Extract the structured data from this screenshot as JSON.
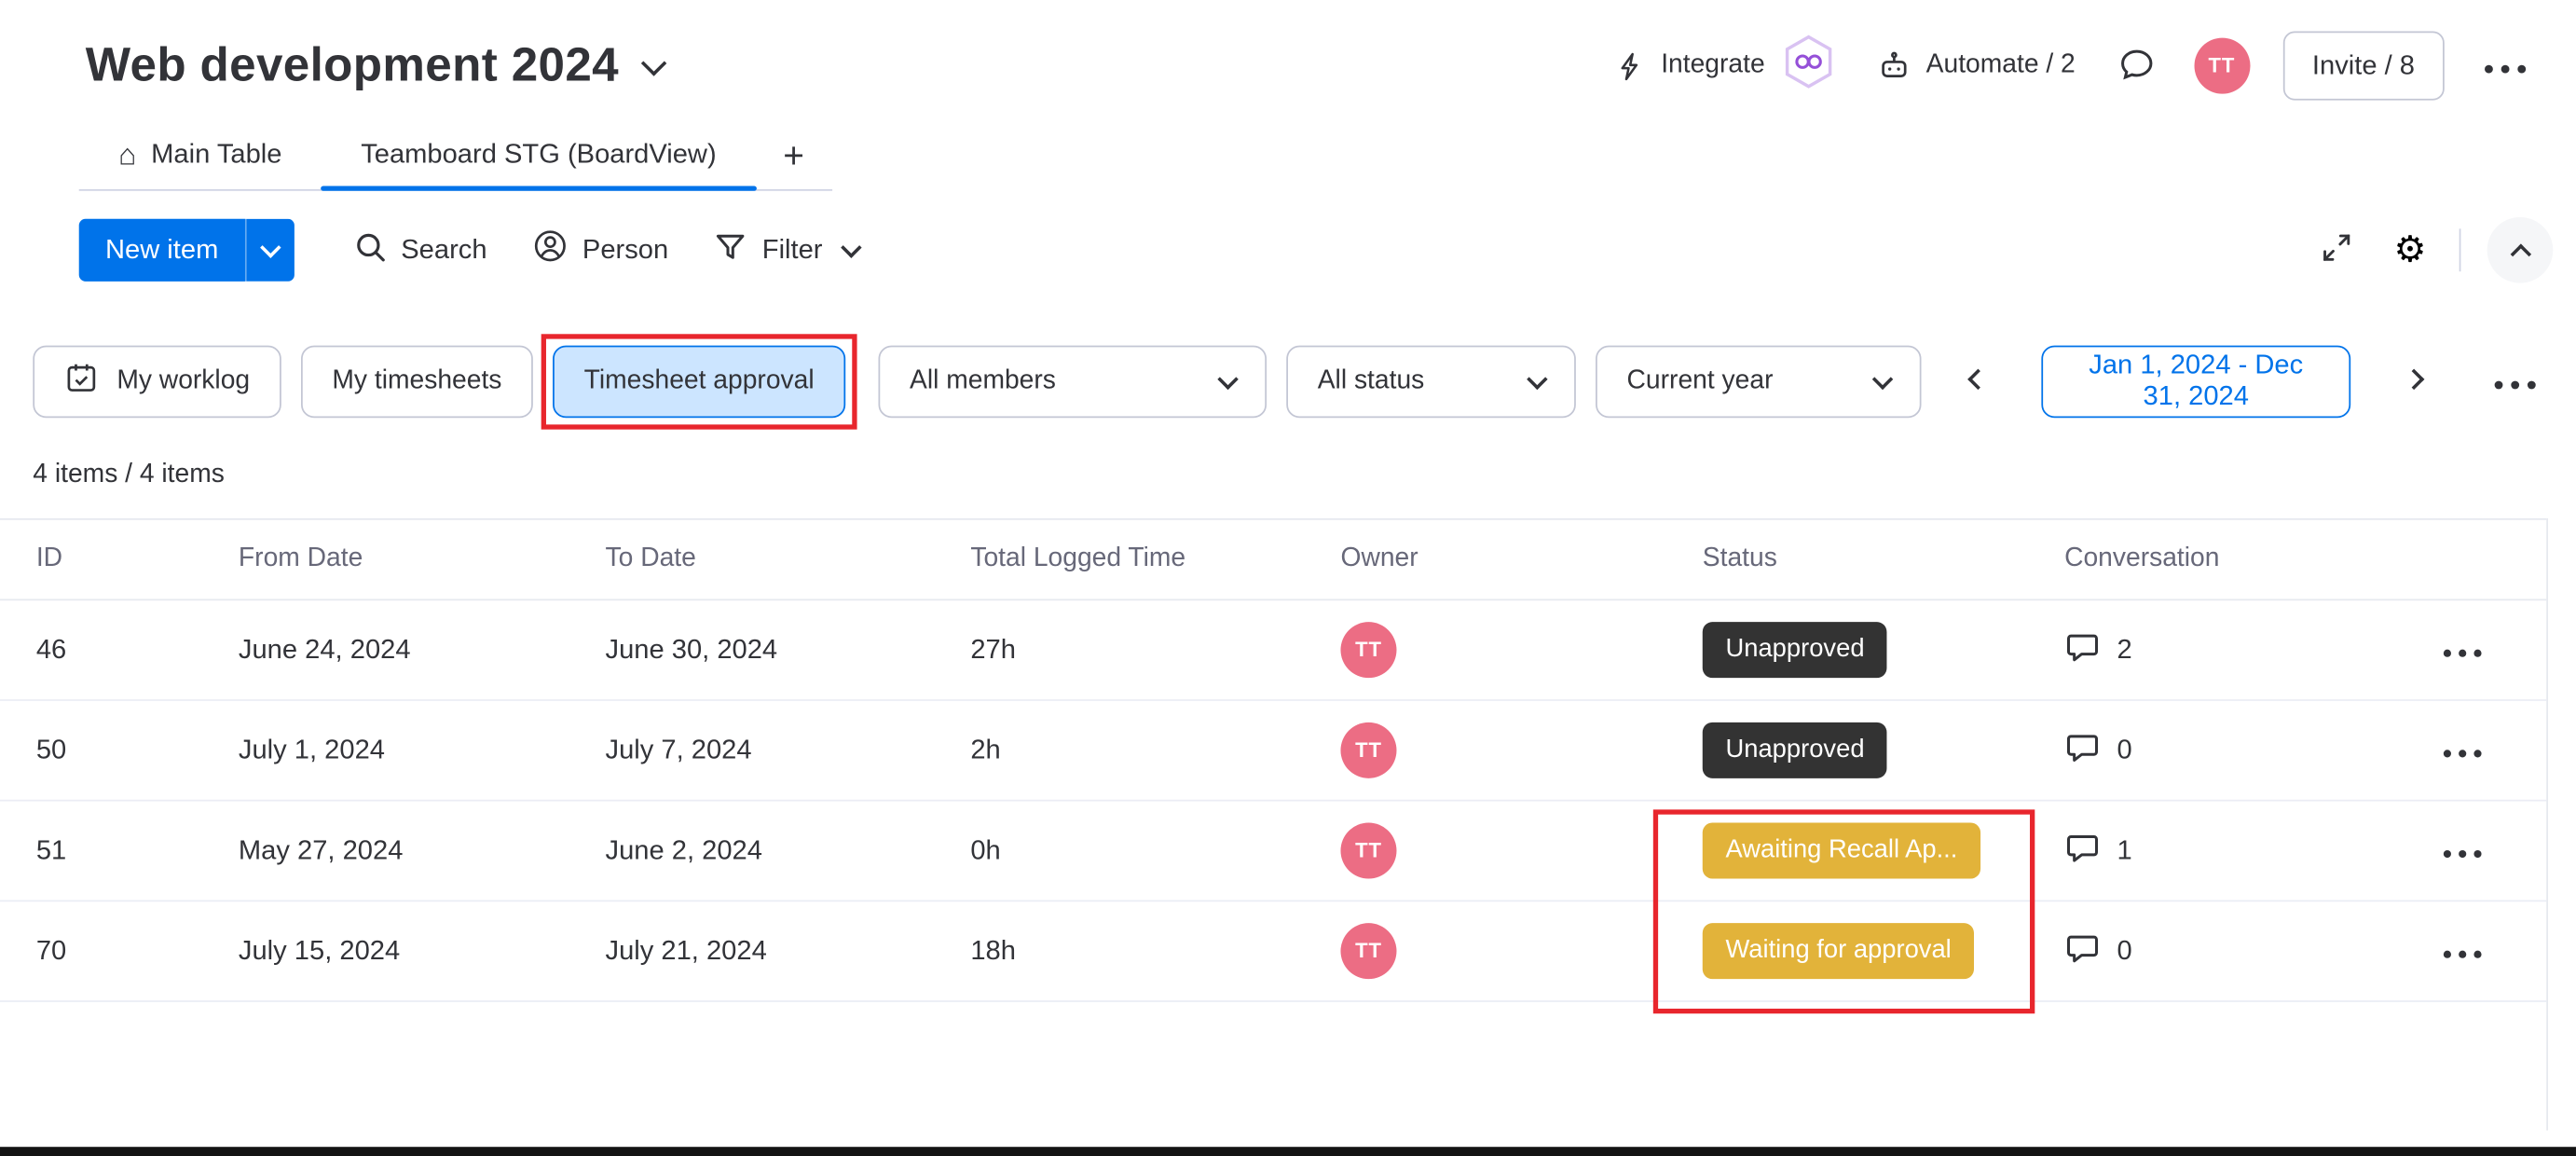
{
  "colors": {
    "accent_blue": "#0073ea",
    "highlight_red": "#e8262d",
    "avatar_pink": "#ec6d84",
    "badge_dark": "#333333",
    "badge_yellow": "#e2b33a",
    "selected_filter_bg": "#cce5ff"
  },
  "icons": {
    "gear": "⚙",
    "home": "⌂",
    "add": "+"
  },
  "header": {
    "board_title": "Web development 2024",
    "integrate_label": "Integrate",
    "automate_label": "Automate / 2",
    "invite_label": "Invite / 8",
    "avatar_initials": "TT"
  },
  "tabs": [
    {
      "label": "Main Table"
    },
    {
      "label": "Teamboard STG (BoardView)"
    }
  ],
  "toolbar": {
    "new_item": "New item",
    "search": "Search",
    "person": "Person",
    "filter": "Filter"
  },
  "filterbar": {
    "my_worklog": "My worklog",
    "my_timesheets": "My timesheets",
    "timesheet_approval": "Timesheet approval",
    "members_value": "All members",
    "status_value": "All status",
    "period_value": "Current year",
    "date_range": "Jan 1, 2024 - Dec 31, 2024"
  },
  "summary": "4 items / 4 items",
  "table": {
    "columns": [
      "ID",
      "From Date",
      "To Date",
      "Total Logged Time",
      "Owner",
      "Status",
      "Conversation"
    ],
    "rows": [
      {
        "id": "46",
        "from_date": "June 24, 2024",
        "to_date": "June 30, 2024",
        "total_logged": "27h",
        "owner_initials": "TT",
        "status": "Unapproved",
        "status_bg": "#333333",
        "conversation_count": "2"
      },
      {
        "id": "50",
        "from_date": "July 1, 2024",
        "to_date": "July 7, 2024",
        "total_logged": "2h",
        "owner_initials": "TT",
        "status": "Unapproved",
        "status_bg": "#333333",
        "conversation_count": "0"
      },
      {
        "id": "51",
        "from_date": "May 27, 2024",
        "to_date": "June 2, 2024",
        "total_logged": "0h",
        "owner_initials": "TT",
        "status": "Awaiting Recall Ap...",
        "status_bg": "#e2b33a",
        "conversation_count": "1"
      },
      {
        "id": "70",
        "from_date": "July 15, 2024",
        "to_date": "July 21, 2024",
        "total_logged": "18h",
        "owner_initials": "TT",
        "status": "Waiting for approval",
        "status_bg": "#e2b33a",
        "conversation_count": "0"
      }
    ]
  }
}
